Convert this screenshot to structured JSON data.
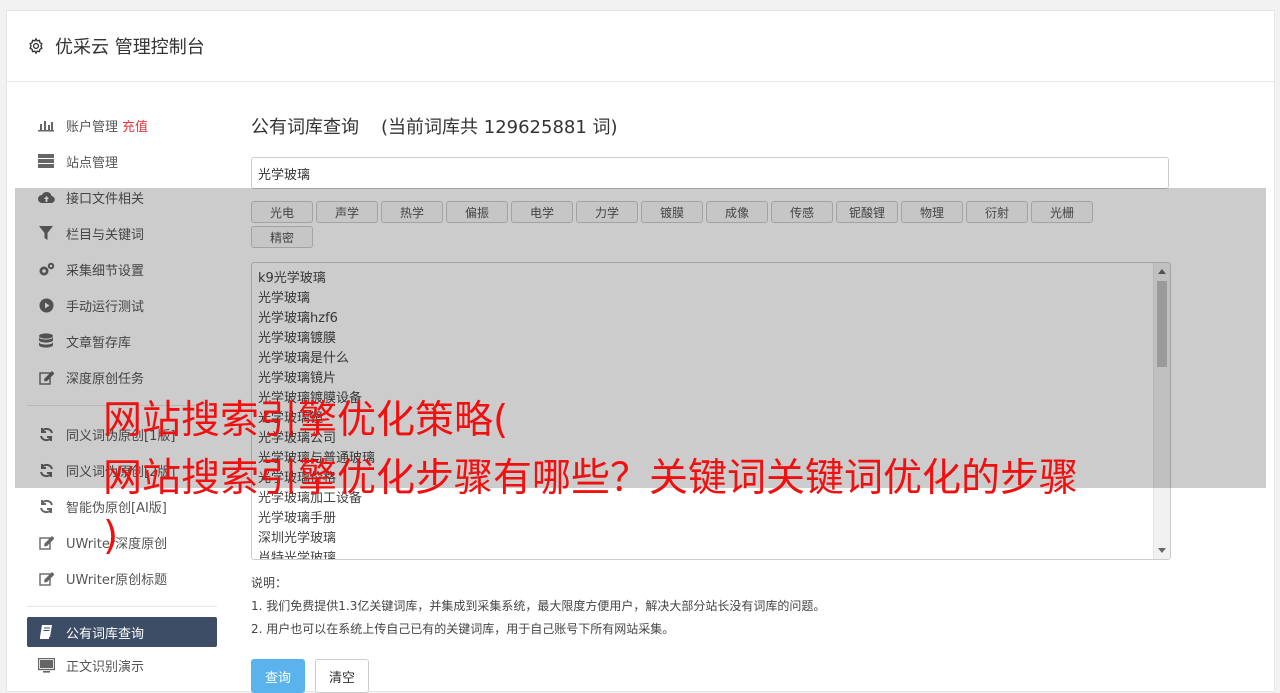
{
  "header": {
    "title": "优采云 管理控制台",
    "icon": "gear-icon"
  },
  "sidebar": {
    "items": [
      {
        "label": "账户管理",
        "badge": "充值",
        "icon": "bar-chart-icon"
      },
      {
        "label": "站点管理",
        "icon": "server-icon"
      },
      {
        "label": "接口文件相关",
        "icon": "cloud-upload-icon"
      },
      {
        "label": "栏目与关键词",
        "icon": "filter-icon"
      },
      {
        "label": "采集细节设置",
        "icon": "cogs-icon"
      },
      {
        "label": "手动运行测试",
        "icon": "play-circle-icon"
      },
      {
        "label": "文章暂存库",
        "icon": "database-icon"
      },
      {
        "label": "深度原创任务",
        "icon": "edit-icon"
      },
      {
        "label": "同义词伪原创[1版]",
        "icon": "refresh-icon"
      },
      {
        "label": "同义词伪原创[2版]",
        "icon": "refresh-icon"
      },
      {
        "label": "智能伪原创[AI版]",
        "icon": "refresh-icon"
      },
      {
        "label": "UWriter深度原创",
        "icon": "edit-icon"
      },
      {
        "label": "UWriter原创标题",
        "icon": "edit-icon"
      },
      {
        "label": "公有词库查询",
        "icon": "book-icon",
        "active": true
      },
      {
        "label": "正文识别演示",
        "icon": "monitor-icon"
      }
    ]
  },
  "main": {
    "title": "公有词库查询",
    "count_text": "(当前词库共 129625881 词)",
    "search_value": "光学玻璃",
    "tags": [
      "光电",
      "声学",
      "热学",
      "偏振",
      "电学",
      "力学",
      "镀膜",
      "成像",
      "传感",
      "铌酸锂",
      "物理",
      "衍射",
      "光栅",
      "精密"
    ],
    "keywords": [
      "k9光学玻璃",
      "光学玻璃",
      "光学玻璃hzf6",
      "光学玻璃镀膜",
      "光学玻璃是什么",
      "光学玻璃镜片",
      "光学玻璃镀膜设备",
      "光学玻璃镜",
      "光学玻璃公司",
      "光学玻璃与普通玻璃",
      "光学玻璃价格",
      "光学玻璃加工设备",
      "光学玻璃手册",
      "深圳光学玻璃",
      "肖特光学玻璃"
    ],
    "notes": {
      "heading": "说明：",
      "lines": [
        "1. 我们免费提供1.3亿关键词库，并集成到采集系统，最大限度方便用户，解决大部分站长没有词库的问题。",
        "2. 用户也可以在系统上传自己已有的关键词库，用于自己账号下所有网站采集。"
      ]
    },
    "buttons": {
      "query": "查询",
      "clear": "清空"
    }
  },
  "watermark": {
    "line1": "网站搜索引擎优化策略(",
    "line2": "网站搜索引擎优化步骤有哪些？关键词关键词优化的步骤",
    "line3": ")"
  },
  "colors": {
    "sidebar_active": "#3e4d66",
    "primary_button": "#5bb3ee",
    "watermark": "#f01010",
    "recharge": "#e4393c"
  }
}
